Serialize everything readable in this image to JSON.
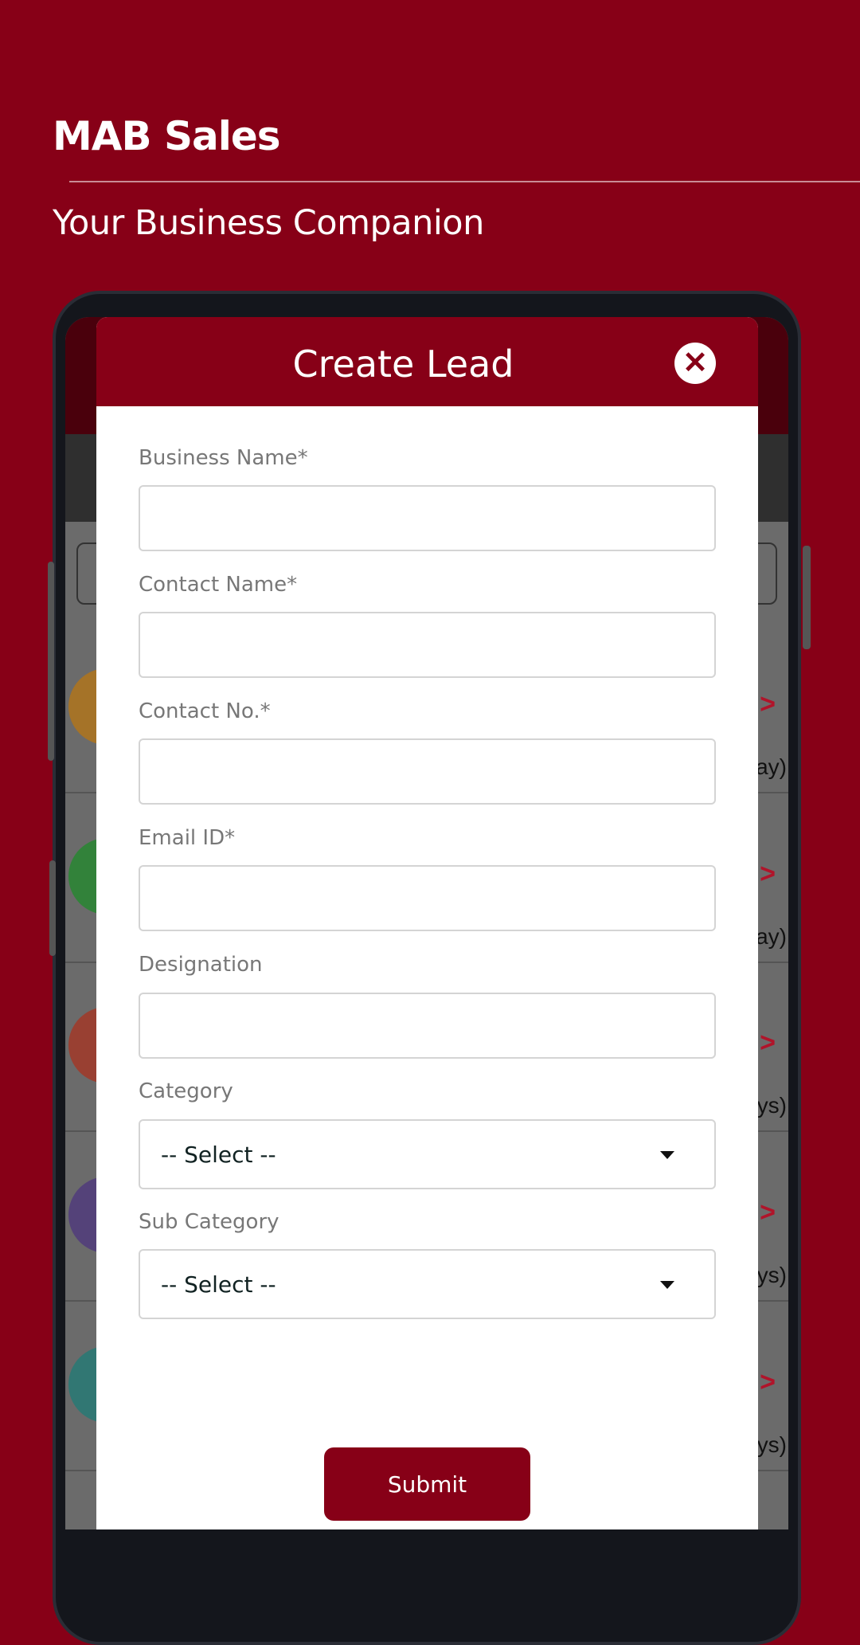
{
  "brand": {
    "title": "MAB Sales",
    "tagline": "Your Business Companion"
  },
  "colors": {
    "brand": "#870017",
    "background": "#870017"
  },
  "background_list": {
    "rows": [
      {
        "avatar_color": "#b87512",
        "fragment": "ay)"
      },
      {
        "avatar_color": "#1f8a2a",
        "fragment": "ay)"
      },
      {
        "avatar_color": "#a8321f",
        "fragment": "ys)"
      },
      {
        "avatar_color": "#4c347e",
        "fragment": "ys)"
      },
      {
        "avatar_color": "#1d7b76",
        "fragment": "ys)"
      }
    ],
    "chevron_icon": "chevron-right-icon"
  },
  "modal": {
    "title": "Create Lead",
    "close_icon": "close-circle-icon",
    "fields": [
      {
        "label": "Business Name*",
        "value": "",
        "type": "text"
      },
      {
        "label": "Contact Name*",
        "value": "",
        "type": "text"
      },
      {
        "label": "Contact No.*",
        "value": "",
        "type": "text"
      },
      {
        "label": "Email ID*",
        "value": "",
        "type": "text"
      },
      {
        "label": "Designation",
        "value": "",
        "type": "text"
      },
      {
        "label": "Category",
        "value": "-- Select --",
        "type": "select"
      },
      {
        "label": "Sub Category",
        "value": "-- Select --",
        "type": "select"
      }
    ],
    "submit_label": "Submit"
  }
}
